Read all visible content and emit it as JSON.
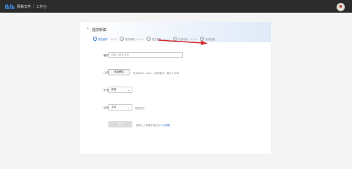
{
  "topbar": {
    "brand": "网易文件",
    "separator": "|",
    "section": "工作台"
  },
  "page": {
    "back_label": "‹",
    "title": "提前新稿"
  },
  "steps": [
    {
      "num": "1",
      "label": "提交稿件",
      "active": true
    },
    {
      "num": "2",
      "label": "格式转换",
      "active": false
    },
    {
      "num": "3",
      "label": "提交排版",
      "active": false
    },
    {
      "num": "4",
      "label": "在线校对",
      "active": false
    },
    {
      "num": "5",
      "label": "完成出版",
      "active": false
    }
  ],
  "form": {
    "name_label": "*稿件名称",
    "name_placeholder": "请输入稿件名称",
    "upload_label": "*上传文件",
    "upload_button": "添加稿件",
    "upload_hint": "仅支持doc、docx、pdf等格式，最大 1.5MB",
    "category_label": "*分类栏目",
    "category_value": "请选",
    "type_label": "*出版类型",
    "type_value": "文本",
    "type_hint": "按照文件",
    "submit_label": "提交",
    "notice_text": "若输入工单编号请点击",
    "notice_link": "人工转稿"
  },
  "colors": {
    "accent": "#2f6fd6",
    "topbar_bg": "#2b2b2b",
    "annotation_arrow": "#d42a2a"
  }
}
